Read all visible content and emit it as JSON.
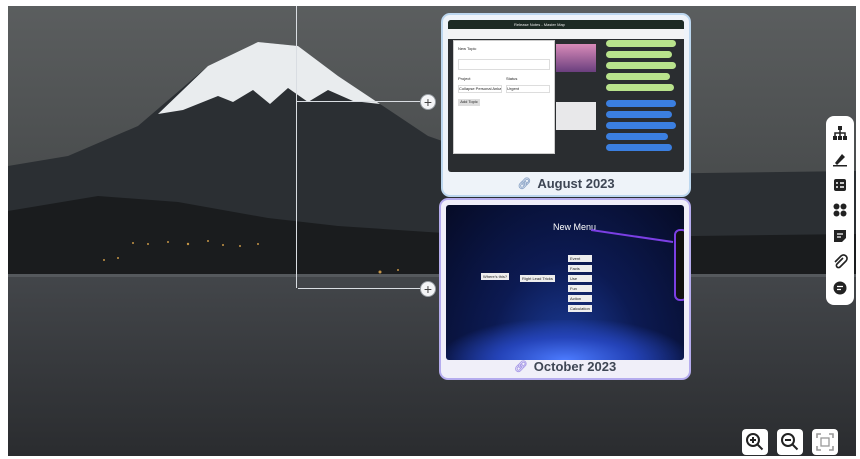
{
  "cards": [
    {
      "title": "August 2023",
      "link_icon": "link-icon",
      "thumb": {
        "app_title": "Release Notes - Master Map",
        "panel_title": "New Topic",
        "field1_label": "Project",
        "field1_value": "Collapse Personal Ankara",
        "field2_label": "Status",
        "field2_value": "Urgent",
        "action_label": "Add Topic"
      }
    },
    {
      "title": "October 2023",
      "link_icon": "link-icon",
      "thumb": {
        "callout": "New Menu",
        "root_node": "Where's this?",
        "child_node": "Right Lead Tricks",
        "leaves": [
          "Event",
          "Facts",
          "Use",
          "Fun",
          "Action",
          "Calculation"
        ]
      }
    }
  ],
  "toolbar": {
    "tools": [
      {
        "name": "org-chart-icon"
      },
      {
        "name": "highlighter-icon"
      },
      {
        "name": "task-icon"
      },
      {
        "name": "group-icon"
      },
      {
        "name": "note-icon"
      },
      {
        "name": "attachment-icon"
      },
      {
        "name": "comment-icon"
      }
    ]
  },
  "zoom": {
    "in": "zoom-in-icon",
    "out": "zoom-out-icon",
    "fit": "fit-screen-icon"
  },
  "colors": {
    "aug_border": "#bcd7ef",
    "oct_border": "#b5acee",
    "accent_purple": "#7b3fe4",
    "node_green": "#b9e38c",
    "node_blue": "#3b7fe0"
  }
}
